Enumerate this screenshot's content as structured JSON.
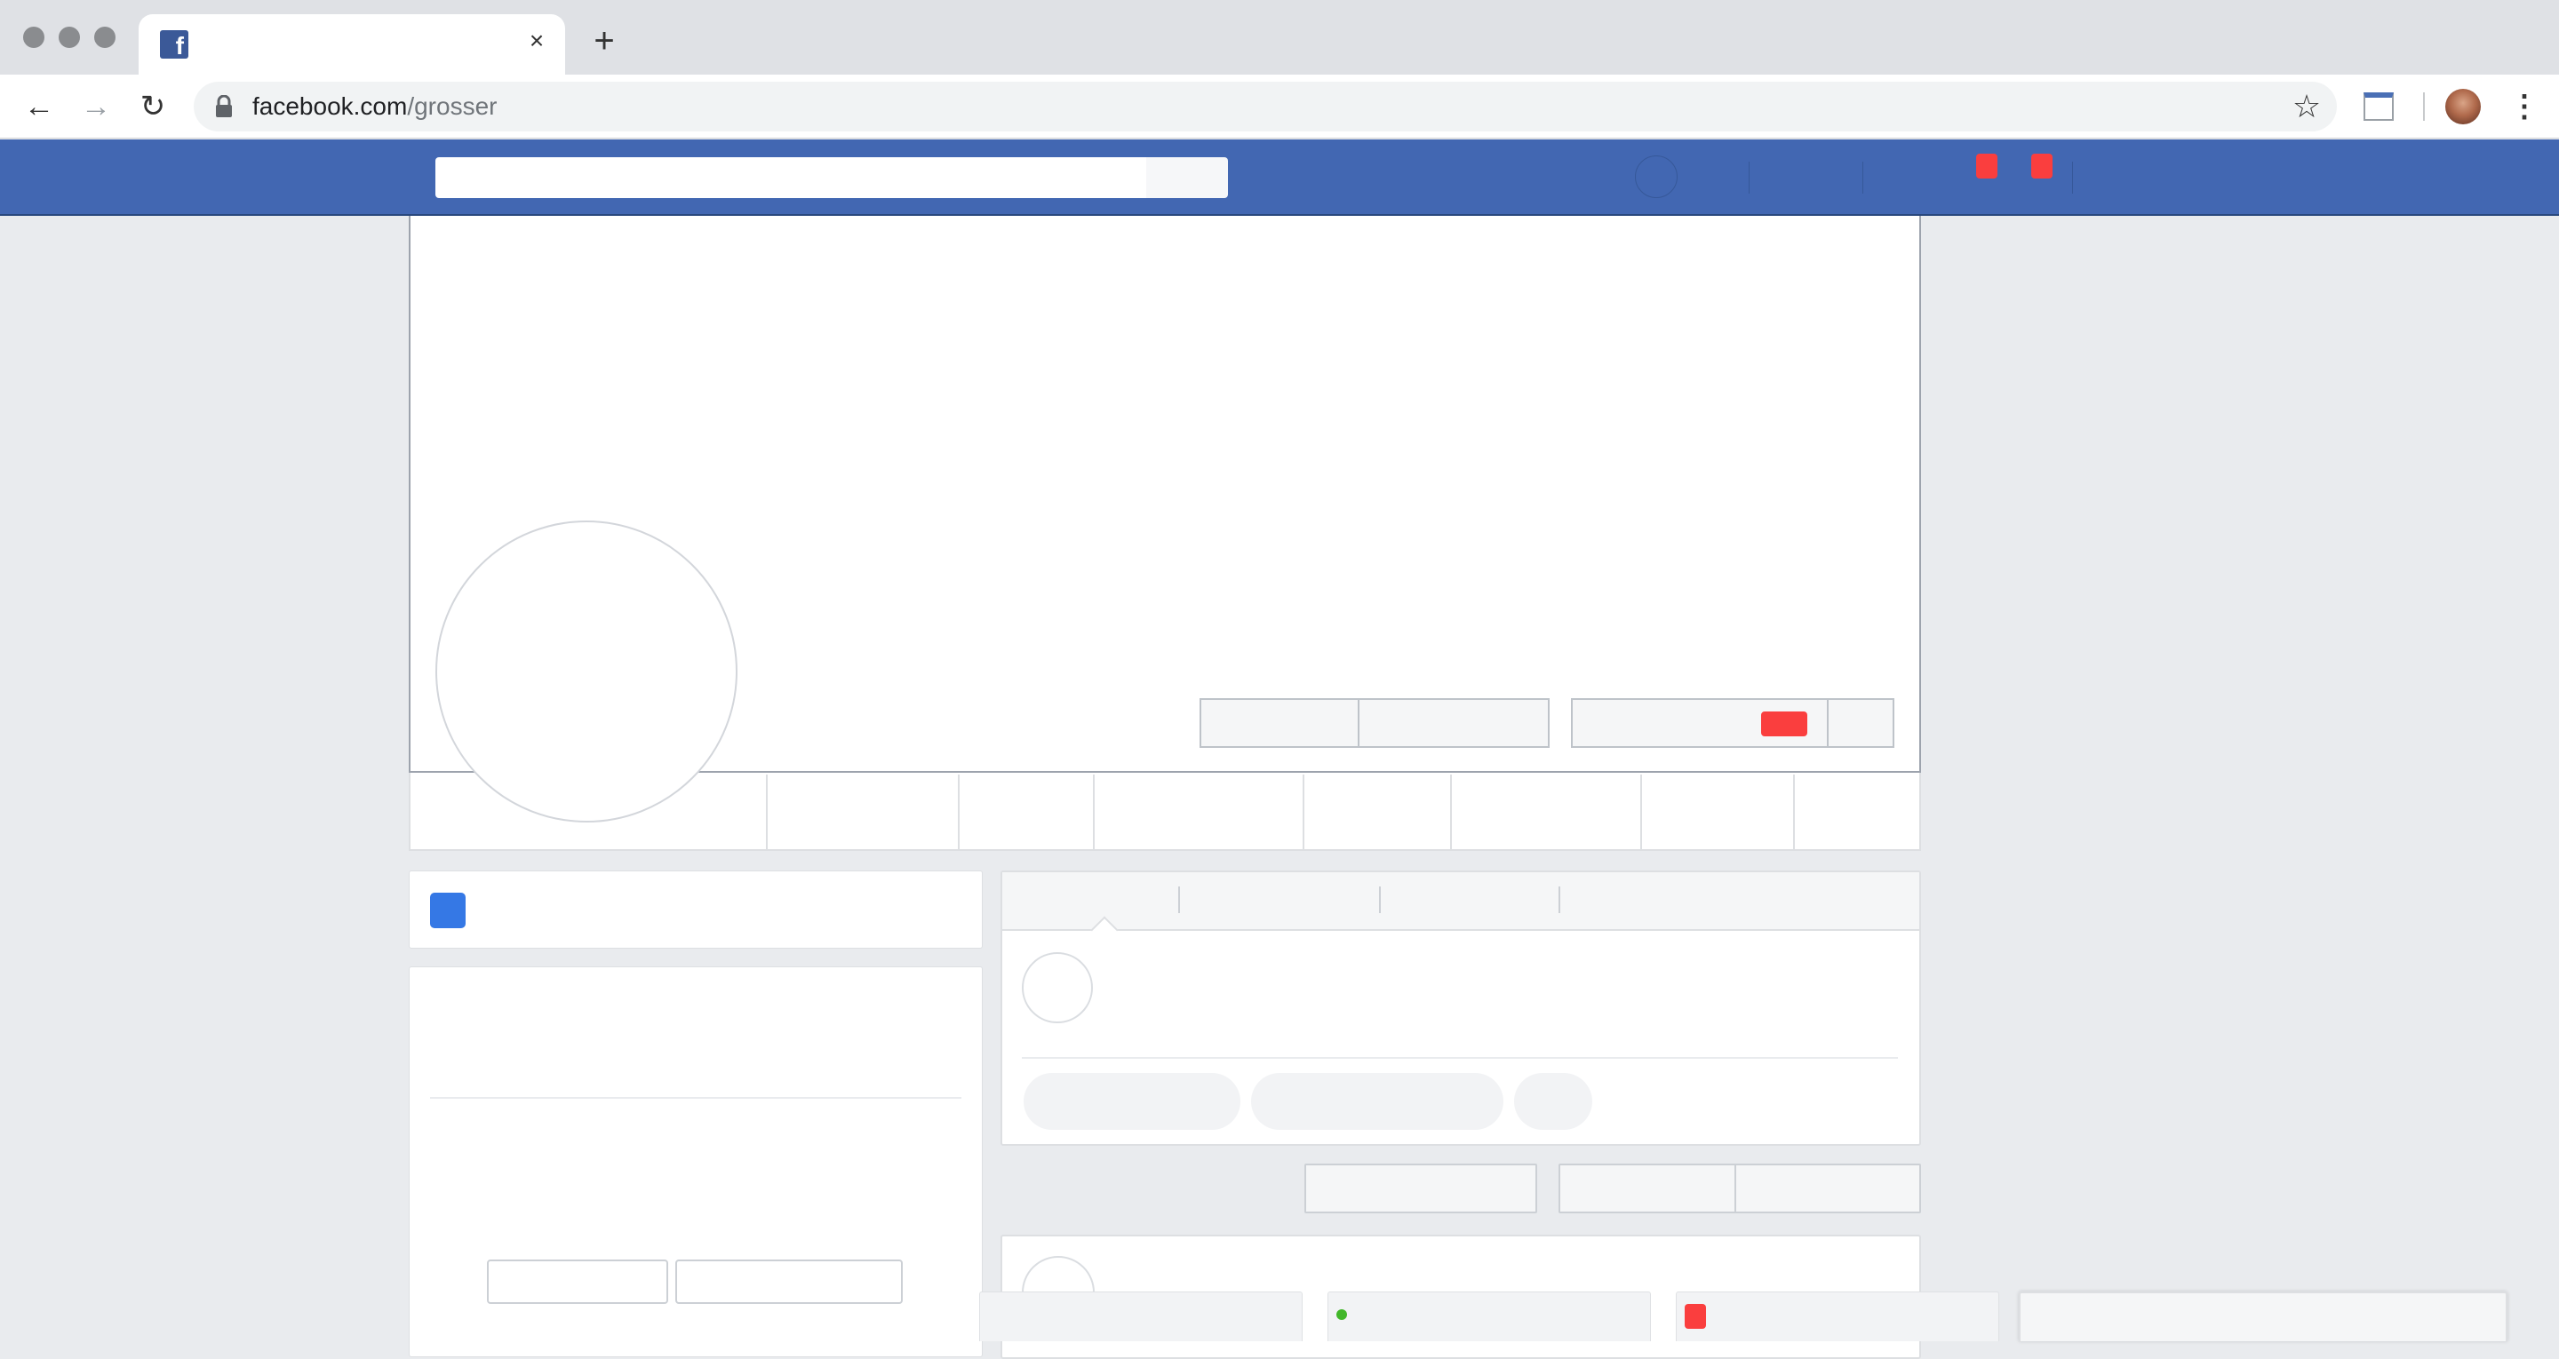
{
  "browser": {
    "tab": {
      "favicon": "facebook-f-icon",
      "favicon_letter": "f",
      "close_glyph": "×"
    },
    "new_tab_glyph": "+",
    "nav": {
      "back_glyph": "←",
      "forward_glyph": "→",
      "reload_glyph": "↻"
    },
    "address": {
      "host": "facebook.com",
      "path": "/grosser"
    },
    "bookmark_glyph": "☆",
    "menu_glyph": "⋮",
    "icons": [
      "lock-icon",
      "star-icon",
      "extension-icon",
      "profile-avatar",
      "menu-icon"
    ]
  },
  "colors": {
    "facebook_blue": "#4267b2",
    "page_background": "#e9ebee",
    "notification_red": "#fa3e3e",
    "intro_icon_blue": "#3578e5",
    "online_green": "#42b72a"
  }
}
